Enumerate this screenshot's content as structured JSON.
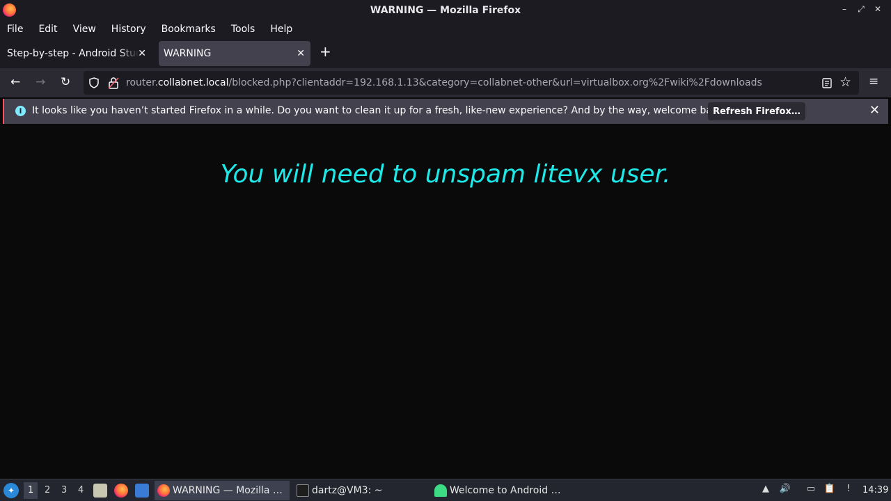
{
  "window": {
    "title": "WARNING — Mozilla Firefox",
    "controls": [
      "–",
      "⤢",
      "✕"
    ]
  },
  "menubar": {
    "items": [
      "File",
      "Edit",
      "View",
      "History",
      "Bookmarks",
      "Tools",
      "Help"
    ]
  },
  "tabs": [
    {
      "label": "Step-by-step - Android Studio"
    },
    {
      "label": "WARNING"
    }
  ],
  "navbar": {
    "url_host_prefix": "router.",
    "url_host": "collabnet.local",
    "url_path": "/blocked.php?clientaddr=192.168.1.13&category=collabnet-other&url=virtualbox.org%2Fwiki%2Fdownloads"
  },
  "notification": {
    "message": "It looks like you haven’t started Firefox in a while. Do you want to clean it up for a fresh, like-new experience? And by the way, welcome back!",
    "button_label": "Refresh Firefox…"
  },
  "content": {
    "headline": "You will need to unspam litevx user.",
    "headline_color": "#1ee9e9"
  },
  "taskbar": {
    "workspaces": [
      "1",
      "2",
      "3",
      "4"
    ],
    "tasks": [
      {
        "label": "WARNING — Mozilla …"
      },
      {
        "label": "dartz@VM3: ~"
      },
      {
        "label": "Welcome to Android …"
      }
    ],
    "clock": "14:39"
  }
}
